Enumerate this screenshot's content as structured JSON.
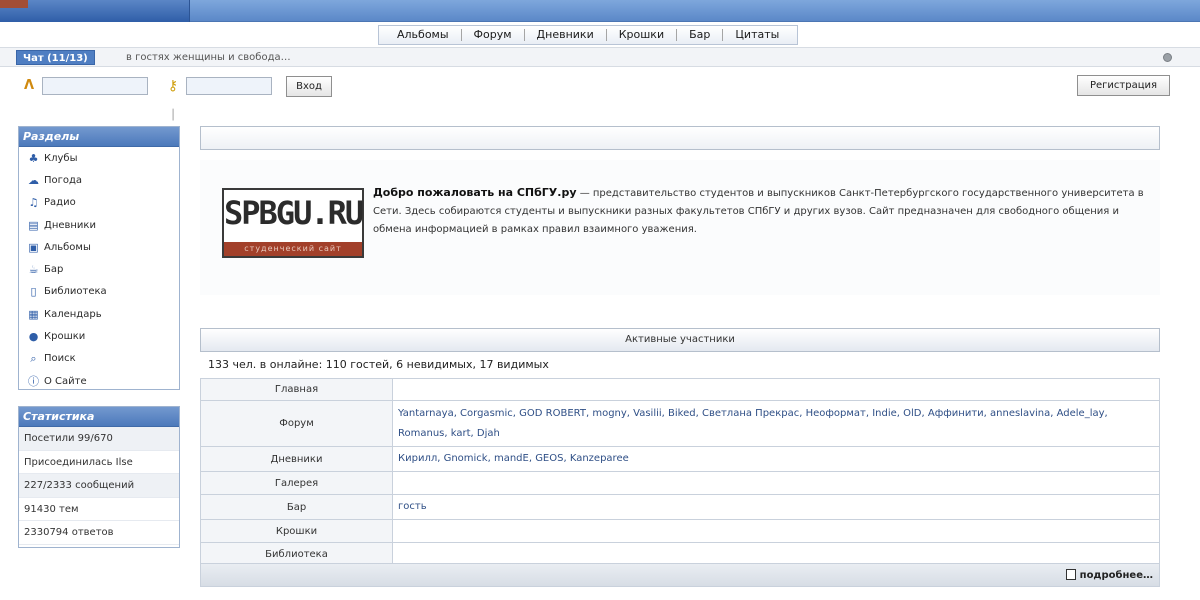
{
  "nav": {
    "items": [
      "Альбомы",
      "Форум",
      "Дневники",
      "Крошки",
      "Бар",
      "Цитаты"
    ]
  },
  "tabbar": {
    "chat_tab": "Чат (11/13)",
    "marquee": "в гостях женщины и свобода…"
  },
  "login": {
    "login_button": "Вход",
    "register_button": "Регистрация"
  },
  "sidebar": {
    "sections_title": "Разделы",
    "items": [
      {
        "label": "Клубы",
        "icon": "clubs-icon"
      },
      {
        "label": "Погода",
        "icon": "weather-icon"
      },
      {
        "label": "Радио",
        "icon": "radio-icon"
      },
      {
        "label": "Дневники",
        "icon": "diary-icon"
      },
      {
        "label": "Альбомы",
        "icon": "album-icon"
      },
      {
        "label": "Бар",
        "icon": "bar-icon"
      },
      {
        "label": "Библиотека",
        "icon": "library-icon"
      },
      {
        "label": "Календарь",
        "icon": "calendar-icon"
      },
      {
        "label": "Крошки",
        "icon": "crumbs-icon"
      },
      {
        "label": "Поиск",
        "icon": "search-icon"
      },
      {
        "label": "О Сайте",
        "icon": "info-icon"
      }
    ],
    "stats_title": "Статистика",
    "stats": [
      "Посетили 99/670",
      "Присоединилась Ilse",
      "227/2333 сообщений",
      "91430 тем",
      "2330794 ответов"
    ]
  },
  "welcome": {
    "logo_text": "SPBGU.RU",
    "logo_subtext": "студенческий сайт",
    "bold_intro": "Добро пожаловать на СПбГУ.ру",
    "text": " — представительство студентов и выпускников Санкт-Петербургского государственного университета в Сети. Здесь собираются студенты и выпускники разных факультетов СПбГУ и других вузов. Сайт предназначен для свободного общения и обмена информацией в рамках правил взаимного уважения."
  },
  "active_users": {
    "header": "Активные участники",
    "summary": "133 чел. в онлайне: 110 гостей, 6 невидимых, 17 видимых",
    "rows": [
      {
        "section": "Главная",
        "names": ""
      },
      {
        "section": "Форум",
        "names": "Yantarnaya, Corgasmic, GOD ROBERT, mogny, Vasilii, Biked, Светлана Прекрас, Неоформат, Indie, OlD, Аффинити, anneslavina, Adele_lay, Romanus, kart, Djah"
      },
      {
        "section": "Дневники",
        "names": "Кирилл, Gnomick, mandE, GEOS, Kanzeparee"
      },
      {
        "section": "Галерея",
        "names": ""
      },
      {
        "section": "Бар",
        "names": "гость"
      },
      {
        "section": "Крошки",
        "names": ""
      },
      {
        "section": "Библиотека",
        "names": ""
      }
    ],
    "more_link": "подробнее…"
  }
}
